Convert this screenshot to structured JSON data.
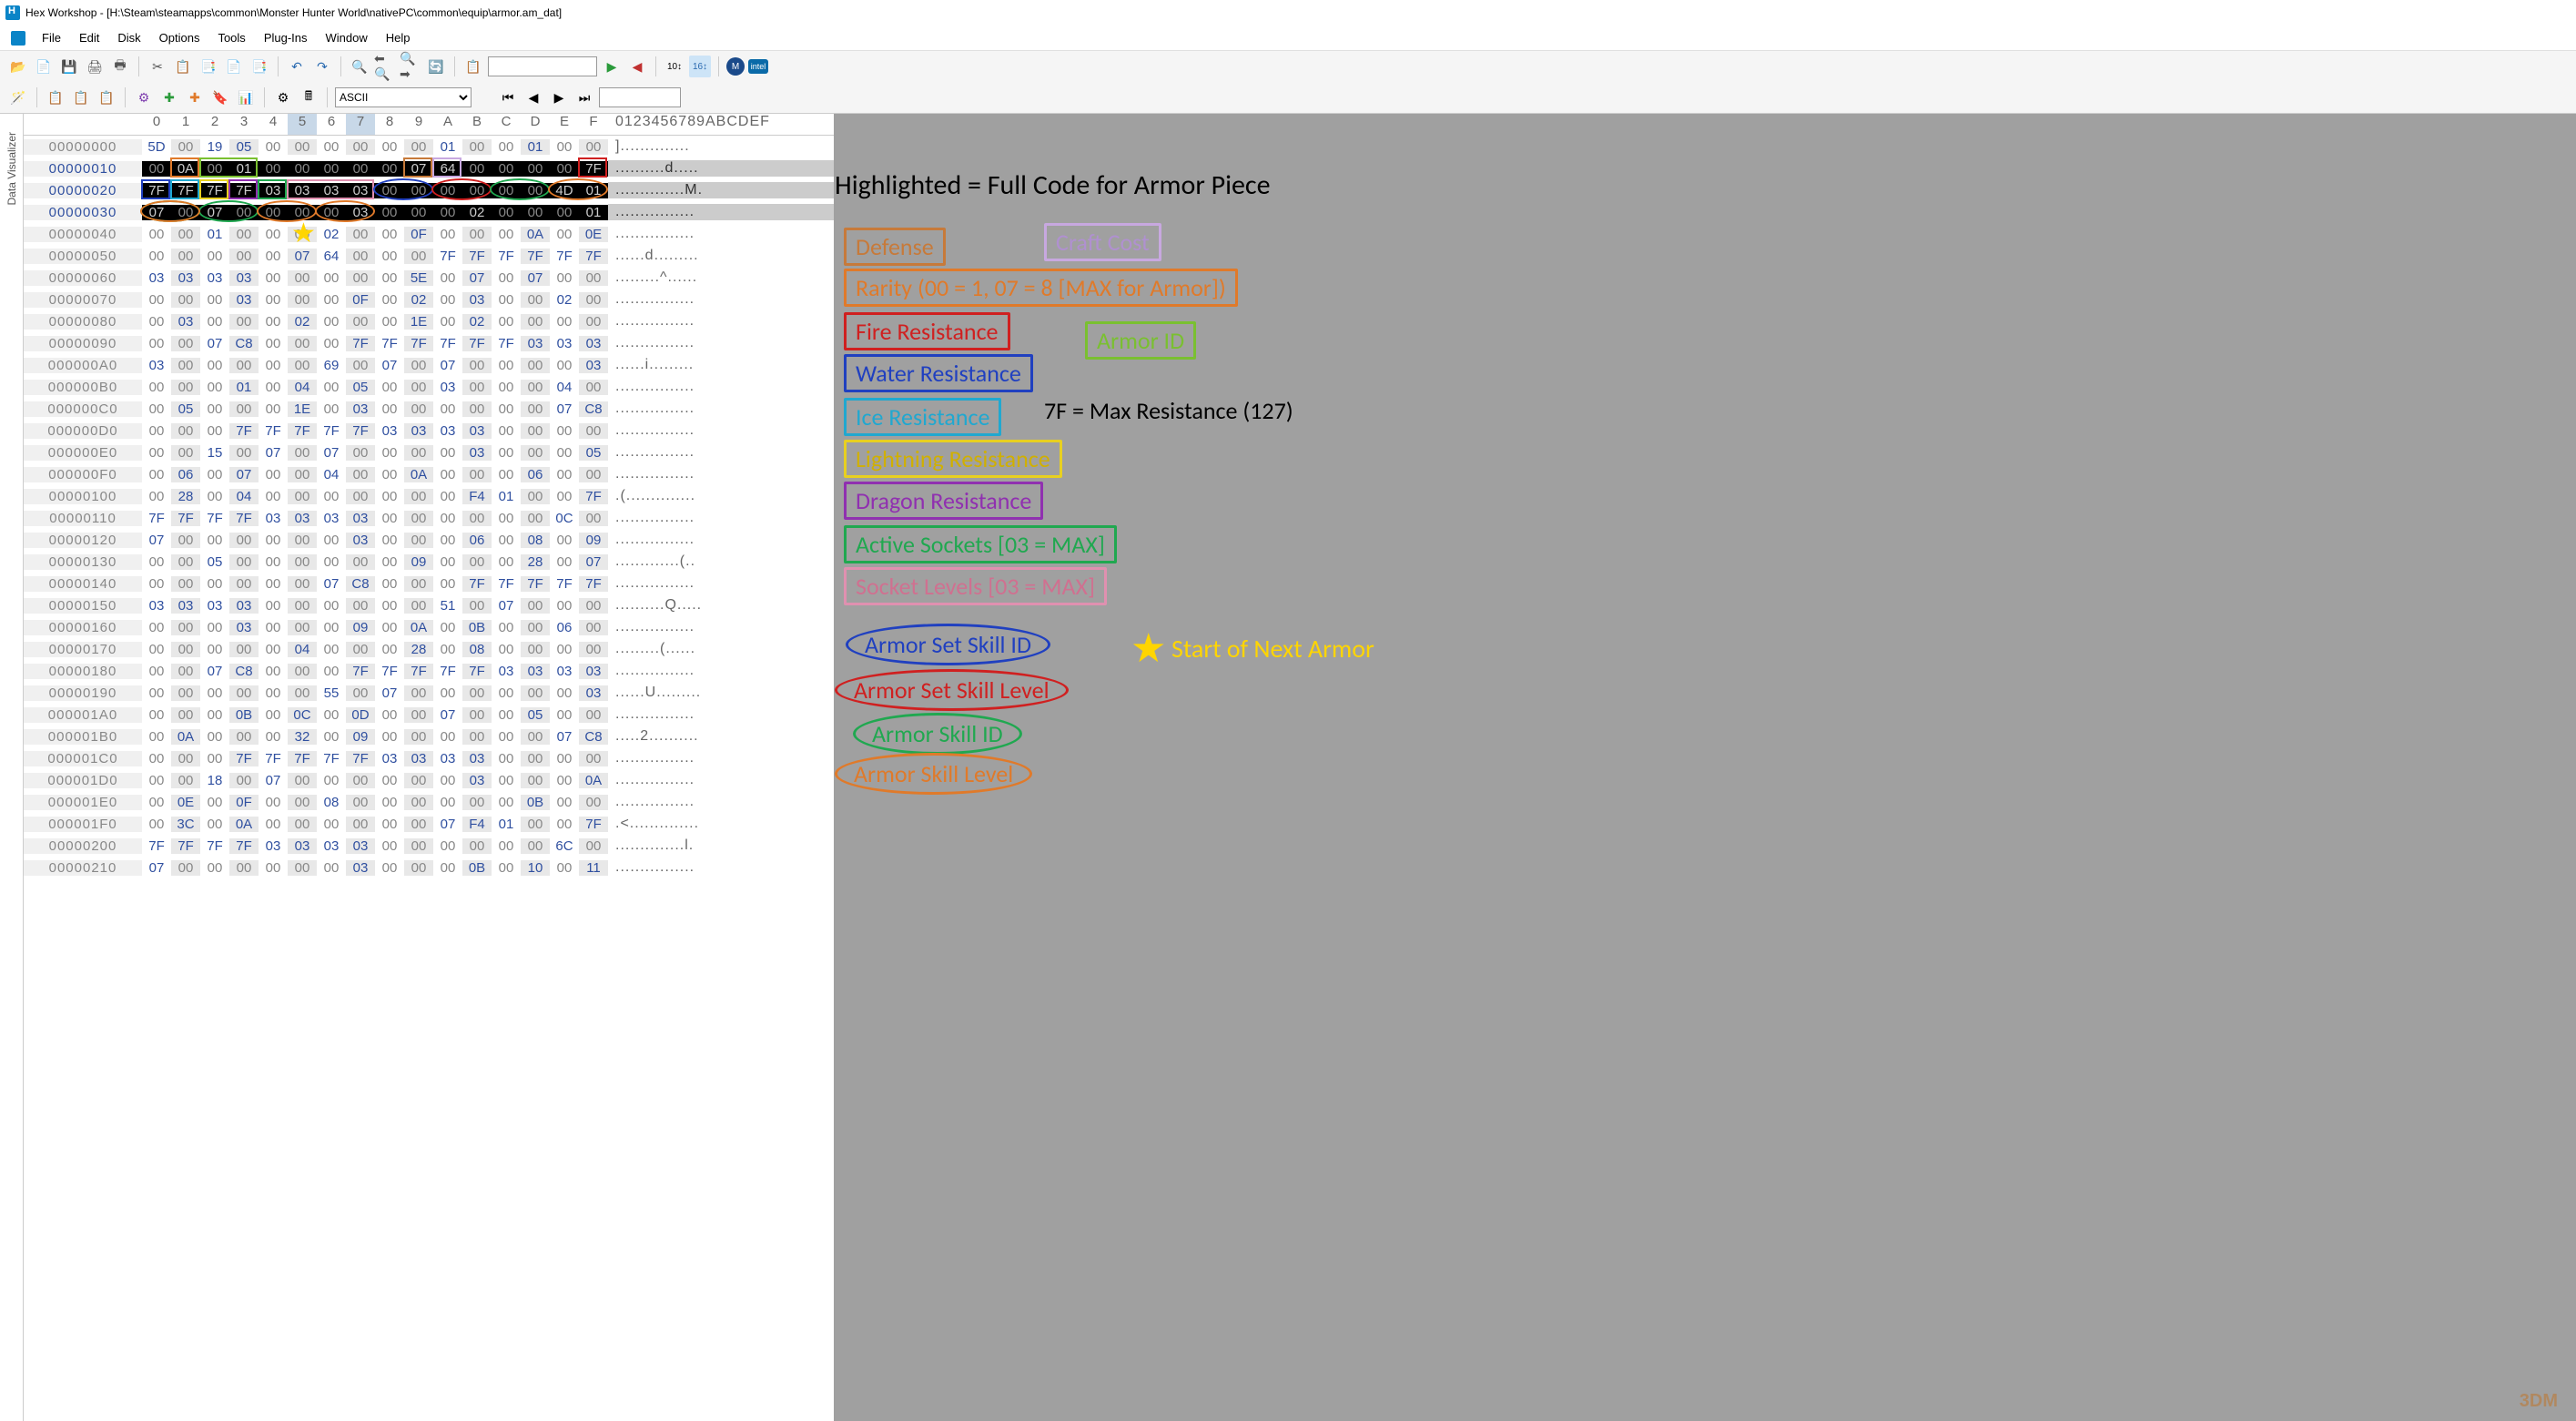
{
  "window": {
    "title": "Hex Workshop - [H:\\Steam\\steamapps\\common\\Monster Hunter World\\nativePC\\common\\equip\\armor.am_dat]"
  },
  "menubar": [
    "File",
    "Edit",
    "Disk",
    "Options",
    "Tools",
    "Plug-Ins",
    "Window",
    "Help"
  ],
  "toolbar": {
    "encoding_label": "ASCII",
    "find_input": ""
  },
  "sidetab": "Data Visualizer",
  "hex": {
    "columns": [
      "0",
      "1",
      "2",
      "3",
      "4",
      "5",
      "6",
      "7",
      "8",
      "9",
      "A",
      "B",
      "C",
      "D",
      "E",
      "F"
    ],
    "ascii_header": "0123456789ABCDEF",
    "highlighted_cols": [
      "5",
      "7"
    ],
    "rows": [
      {
        "off": "00000000",
        "b": [
          "5D",
          "00",
          "19",
          "05",
          "00",
          "00",
          "00",
          "00",
          "00",
          "00",
          "01",
          "00",
          "00",
          "01",
          "00",
          "00"
        ],
        "a": "].............. ",
        "inv": false
      },
      {
        "off": "00000010",
        "b": [
          "00",
          "0A",
          "00",
          "01",
          "00",
          "00",
          "00",
          "00",
          "00",
          "07",
          "64",
          "00",
          "00",
          "00",
          "00",
          "7F"
        ],
        "a": "..........d.....",
        "inv": true
      },
      {
        "off": "00000020",
        "b": [
          "7F",
          "7F",
          "7F",
          "7F",
          "03",
          "03",
          "03",
          "03",
          "00",
          "00",
          "00",
          "00",
          "00",
          "00",
          "4D",
          "01"
        ],
        "a": "..............M.",
        "inv": true
      },
      {
        "off": "00000030",
        "b": [
          "07",
          "00",
          "07",
          "00",
          "00",
          "00",
          "00",
          "03",
          "00",
          "00",
          "00",
          "02",
          "00",
          "00",
          "00",
          "01"
        ],
        "a": "................",
        "inv": true
      },
      {
        "off": "00000040",
        "b": [
          "00",
          "00",
          "01",
          "00",
          "00",
          "00",
          "02",
          "00",
          "00",
          "0F",
          "00",
          "00",
          "00",
          "0A",
          "00",
          "0E"
        ],
        "a": "................",
        "inv": false
      },
      {
        "off": "00000050",
        "b": [
          "00",
          "00",
          "00",
          "00",
          "00",
          "07",
          "64",
          "00",
          "00",
          "00",
          "7F",
          "7F",
          "7F",
          "7F",
          "7F",
          "7F"
        ],
        "a": "......d.........",
        "inv": false
      },
      {
        "off": "00000060",
        "b": [
          "03",
          "03",
          "03",
          "03",
          "00",
          "00",
          "00",
          "00",
          "00",
          "5E",
          "00",
          "07",
          "00",
          "07",
          "00",
          "00"
        ],
        "a": ".........^......",
        "inv": false
      },
      {
        "off": "00000070",
        "b": [
          "00",
          "00",
          "00",
          "03",
          "00",
          "00",
          "00",
          "0F",
          "00",
          "02",
          "00",
          "03",
          "00",
          "00",
          "02",
          "00"
        ],
        "a": "................",
        "inv": false
      },
      {
        "off": "00000080",
        "b": [
          "00",
          "03",
          "00",
          "00",
          "00",
          "02",
          "00",
          "00",
          "00",
          "1E",
          "00",
          "02",
          "00",
          "00",
          "00",
          "00"
        ],
        "a": "................",
        "inv": false
      },
      {
        "off": "00000090",
        "b": [
          "00",
          "00",
          "07",
          "C8",
          "00",
          "00",
          "00",
          "7F",
          "7F",
          "7F",
          "7F",
          "7F",
          "7F",
          "03",
          "03",
          "03"
        ],
        "a": "................",
        "inv": false
      },
      {
        "off": "000000A0",
        "b": [
          "03",
          "00",
          "00",
          "00",
          "00",
          "00",
          "69",
          "00",
          "07",
          "00",
          "07",
          "00",
          "00",
          "00",
          "00",
          "03"
        ],
        "a": "......i.........",
        "inv": false
      },
      {
        "off": "000000B0",
        "b": [
          "00",
          "00",
          "00",
          "01",
          "00",
          "04",
          "00",
          "05",
          "00",
          "00",
          "03",
          "00",
          "00",
          "00",
          "04",
          "00"
        ],
        "a": "................",
        "inv": false
      },
      {
        "off": "000000C0",
        "b": [
          "00",
          "05",
          "00",
          "00",
          "00",
          "1E",
          "00",
          "03",
          "00",
          "00",
          "00",
          "00",
          "00",
          "00",
          "07",
          "C8"
        ],
        "a": "................",
        "inv": false
      },
      {
        "off": "000000D0",
        "b": [
          "00",
          "00",
          "00",
          "7F",
          "7F",
          "7F",
          "7F",
          "7F",
          "03",
          "03",
          "03",
          "03",
          "00",
          "00",
          "00",
          "00"
        ],
        "a": "................",
        "inv": false
      },
      {
        "off": "000000E0",
        "b": [
          "00",
          "00",
          "15",
          "00",
          "07",
          "00",
          "07",
          "00",
          "00",
          "00",
          "00",
          "03",
          "00",
          "00",
          "00",
          "05"
        ],
        "a": "................",
        "inv": false
      },
      {
        "off": "000000F0",
        "b": [
          "00",
          "06",
          "00",
          "07",
          "00",
          "00",
          "04",
          "00",
          "00",
          "0A",
          "00",
          "00",
          "00",
          "06",
          "00",
          "00"
        ],
        "a": "................",
        "inv": false
      },
      {
        "off": "00000100",
        "b": [
          "00",
          "28",
          "00",
          "04",
          "00",
          "00",
          "00",
          "00",
          "00",
          "00",
          "00",
          "F4",
          "01",
          "00",
          "00",
          "7F"
        ],
        "a": ".(..............",
        "inv": false
      },
      {
        "off": "00000110",
        "b": [
          "7F",
          "7F",
          "7F",
          "7F",
          "03",
          "03",
          "03",
          "03",
          "00",
          "00",
          "00",
          "00",
          "00",
          "00",
          "0C",
          "00"
        ],
        "a": "................",
        "inv": false
      },
      {
        "off": "00000120",
        "b": [
          "07",
          "00",
          "00",
          "00",
          "00",
          "00",
          "00",
          "03",
          "00",
          "00",
          "00",
          "06",
          "00",
          "08",
          "00",
          "09"
        ],
        "a": "................",
        "inv": false
      },
      {
        "off": "00000130",
        "b": [
          "00",
          "00",
          "05",
          "00",
          "00",
          "00",
          "00",
          "00",
          "00",
          "09",
          "00",
          "00",
          "00",
          "28",
          "00",
          "07"
        ],
        "a": ".............(..",
        "inv": false
      },
      {
        "off": "00000140",
        "b": [
          "00",
          "00",
          "00",
          "00",
          "00",
          "00",
          "07",
          "C8",
          "00",
          "00",
          "00",
          "7F",
          "7F",
          "7F",
          "7F",
          "7F"
        ],
        "a": "................",
        "inv": false
      },
      {
        "off": "00000150",
        "b": [
          "03",
          "03",
          "03",
          "03",
          "00",
          "00",
          "00",
          "00",
          "00",
          "00",
          "51",
          "00",
          "07",
          "00",
          "00",
          "00"
        ],
        "a": "..........Q.....",
        "inv": false
      },
      {
        "off": "00000160",
        "b": [
          "00",
          "00",
          "00",
          "03",
          "00",
          "00",
          "00",
          "09",
          "00",
          "0A",
          "00",
          "0B",
          "00",
          "00",
          "06",
          "00"
        ],
        "a": "................",
        "inv": false
      },
      {
        "off": "00000170",
        "b": [
          "00",
          "00",
          "00",
          "00",
          "00",
          "04",
          "00",
          "00",
          "00",
          "28",
          "00",
          "08",
          "00",
          "00",
          "00",
          "00"
        ],
        "a": ".........(......",
        "inv": false
      },
      {
        "off": "00000180",
        "b": [
          "00",
          "00",
          "07",
          "C8",
          "00",
          "00",
          "00",
          "7F",
          "7F",
          "7F",
          "7F",
          "7F",
          "03",
          "03",
          "03",
          "03"
        ],
        "a": "................",
        "inv": false
      },
      {
        "off": "00000190",
        "b": [
          "00",
          "00",
          "00",
          "00",
          "00",
          "00",
          "55",
          "00",
          "07",
          "00",
          "00",
          "00",
          "00",
          "00",
          "00",
          "03"
        ],
        "a": "......U.........",
        "inv": false
      },
      {
        "off": "000001A0",
        "b": [
          "00",
          "00",
          "00",
          "0B",
          "00",
          "0C",
          "00",
          "0D",
          "00",
          "00",
          "07",
          "00",
          "00",
          "05",
          "00",
          "00"
        ],
        "a": "................",
        "inv": false
      },
      {
        "off": "000001B0",
        "b": [
          "00",
          "0A",
          "00",
          "00",
          "00",
          "32",
          "00",
          "09",
          "00",
          "00",
          "00",
          "00",
          "00",
          "00",
          "07",
          "C8"
        ],
        "a": ".....2..........",
        "inv": false
      },
      {
        "off": "000001C0",
        "b": [
          "00",
          "00",
          "00",
          "7F",
          "7F",
          "7F",
          "7F",
          "7F",
          "03",
          "03",
          "03",
          "03",
          "00",
          "00",
          "00",
          "00"
        ],
        "a": "................",
        "inv": false
      },
      {
        "off": "000001D0",
        "b": [
          "00",
          "00",
          "18",
          "00",
          "07",
          "00",
          "00",
          "00",
          "00",
          "00",
          "00",
          "03",
          "00",
          "00",
          "00",
          "0A"
        ],
        "a": "................",
        "inv": false
      },
      {
        "off": "000001E0",
        "b": [
          "00",
          "0E",
          "00",
          "0F",
          "00",
          "00",
          "08",
          "00",
          "00",
          "00",
          "00",
          "00",
          "00",
          "0B",
          "00",
          "00"
        ],
        "a": "................",
        "inv": false
      },
      {
        "off": "000001F0",
        "b": [
          "00",
          "3C",
          "00",
          "0A",
          "00",
          "00",
          "00",
          "00",
          "00",
          "00",
          "07",
          "F4",
          "01",
          "00",
          "00",
          "7F"
        ],
        "a": ".<..............",
        "inv": false
      },
      {
        "off": "00000200",
        "b": [
          "7F",
          "7F",
          "7F",
          "7F",
          "03",
          "03",
          "03",
          "03",
          "00",
          "00",
          "00",
          "00",
          "00",
          "00",
          "6C",
          "00"
        ],
        "a": "..............l.",
        "inv": false
      },
      {
        "off": "00000210",
        "b": [
          "07",
          "00",
          "00",
          "00",
          "00",
          "00",
          "00",
          "03",
          "00",
          "00",
          "00",
          "0B",
          "00",
          "10",
          "00",
          "11"
        ],
        "a": "................",
        "inv": false
      }
    ]
  },
  "legend": {
    "title": "Highlighted = Full Code for Armor Piece",
    "defense": "Defense",
    "craft": "Craft Cost",
    "rarity": "Rarity (00 = 1, 07 = 8 [MAX for Armor])",
    "fire": "Fire Resistance",
    "armorid": "Armor ID",
    "water": "Water Resistance",
    "ice": "Ice Resistance",
    "maxres": "7F = Max Resistance (127)",
    "lightning": "Lightning Resistance",
    "dragon": "Dragon Resistance",
    "sockets": "Active Sockets [03 = MAX]",
    "socklvl": "Socket Levels [03 = MAX]",
    "setskill": "Armor Set Skill ID",
    "setlvl": "Armor Set Skill Level",
    "skillid": "Armor Skill ID",
    "skilllvl": "Armor Skill Level",
    "nextarmor": "Start of Next Armor"
  },
  "watermark": "3DM"
}
